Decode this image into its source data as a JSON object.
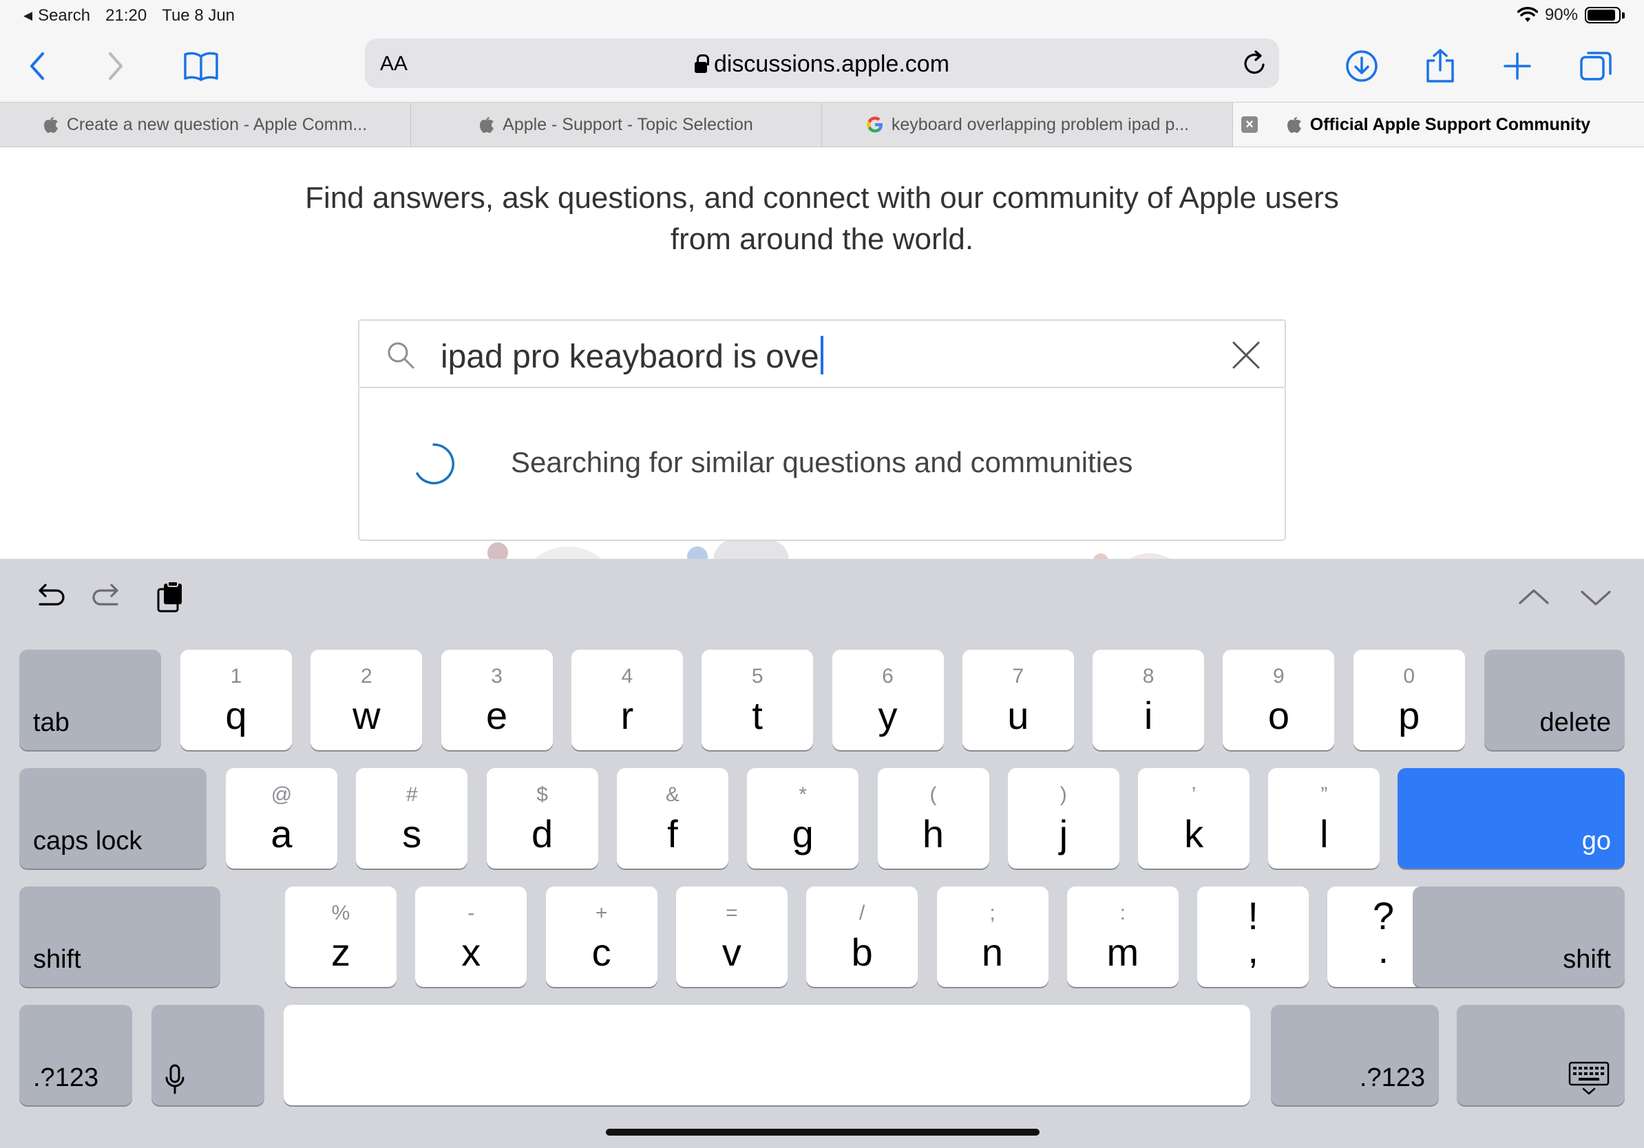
{
  "status": {
    "back_app": "Search",
    "time": "21:20",
    "date": "Tue 8 Jun",
    "battery": "90%",
    "battery_level": 0.9
  },
  "toolbar": {
    "aa": "AA",
    "url": "discussions.apple.com"
  },
  "tabs": [
    {
      "title": "Create a new question - Apple Comm...",
      "icon": "apple-icon",
      "active": false
    },
    {
      "title": "Apple - Support - Topic Selection",
      "icon": "apple-icon",
      "active": false
    },
    {
      "title": "keyboard overlapping problem ipad p...",
      "icon": "google-icon",
      "active": false
    },
    {
      "title": "Official Apple Support Community",
      "icon": "apple-icon",
      "active": true
    }
  ],
  "page": {
    "intro_line1": "Find answers, ask questions, and connect with our community of Apple users",
    "intro_line2": "from around the world.",
    "search_value": "ipad pro keaybaord is ove",
    "loading_text": "Searching for similar questions and communities"
  },
  "keyboard": {
    "row1": [
      {
        "sub": "1",
        "main": "q"
      },
      {
        "sub": "2",
        "main": "w"
      },
      {
        "sub": "3",
        "main": "e"
      },
      {
        "sub": "4",
        "main": "r"
      },
      {
        "sub": "5",
        "main": "t"
      },
      {
        "sub": "6",
        "main": "y"
      },
      {
        "sub": "7",
        "main": "u"
      },
      {
        "sub": "8",
        "main": "i"
      },
      {
        "sub": "9",
        "main": "o"
      },
      {
        "sub": "0",
        "main": "p"
      }
    ],
    "row2": [
      {
        "sub": "@",
        "main": "a"
      },
      {
        "sub": "#",
        "main": "s"
      },
      {
        "sub": "$",
        "main": "d"
      },
      {
        "sub": "&",
        "main": "f"
      },
      {
        "sub": "*",
        "main": "g"
      },
      {
        "sub": "(",
        "main": "h"
      },
      {
        "sub": ")",
        "main": "j"
      },
      {
        "sub": "’",
        "main": "k"
      },
      {
        "sub": "”",
        "main": "l"
      }
    ],
    "row3": [
      {
        "sub": "%",
        "main": "z"
      },
      {
        "sub": "-",
        "main": "x"
      },
      {
        "sub": "+",
        "main": "c"
      },
      {
        "sub": "=",
        "main": "v"
      },
      {
        "sub": "/",
        "main": "b"
      },
      {
        "sub": ";",
        "main": "n"
      },
      {
        "sub": ":",
        "main": "m"
      },
      {
        "sub": "!",
        "main": ","
      },
      {
        "sub": "?",
        "main": "."
      }
    ],
    "tab": "tab",
    "delete": "delete",
    "caps_lock": "caps lock",
    "go": "go",
    "shift": "shift",
    "numbers": ".?123"
  },
  "colors": {
    "go_key": "#2f7af6",
    "accent": "#1f6feb",
    "toolbar_icons": "#1a73e8"
  }
}
